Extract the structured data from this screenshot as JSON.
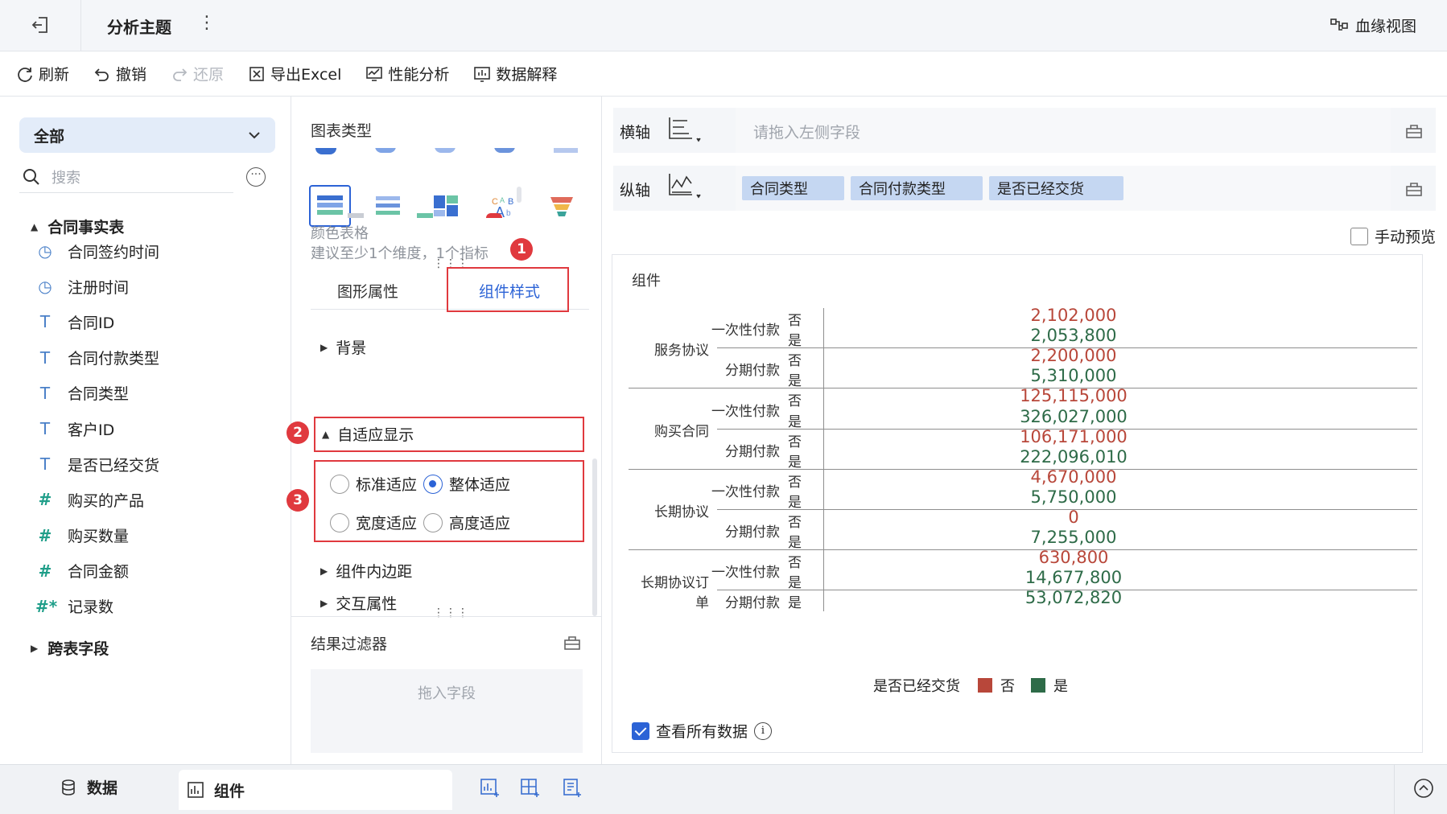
{
  "header": {
    "title": "分析主题",
    "lineage_label": "血缘视图"
  },
  "toolbar": {
    "refresh": "刷新",
    "undo": "撤销",
    "redo": "还原",
    "export_excel": "导出Excel",
    "perf_analysis": "性能分析",
    "data_explain": "数据解释"
  },
  "left_panel": {
    "scope": "全部",
    "search_placeholder": "搜索",
    "table_name": "合同事实表",
    "fields": [
      {
        "label": "合同签约时间",
        "icon": "clock-icon"
      },
      {
        "label": "注册时间",
        "icon": "clock-icon"
      },
      {
        "label": "合同ID",
        "icon": "text-type-icon"
      },
      {
        "label": "合同付款类型",
        "icon": "text-type-icon"
      },
      {
        "label": "合同类型",
        "icon": "text-type-icon"
      },
      {
        "label": "客户ID",
        "icon": "text-type-icon"
      },
      {
        "label": "是否已经交货",
        "icon": "text-type-icon"
      },
      {
        "label": "购买的产品",
        "icon": "number-type-icon"
      },
      {
        "label": "购买数量",
        "icon": "number-type-icon"
      },
      {
        "label": "合同金额",
        "icon": "number-type-icon"
      },
      {
        "label": "记录数",
        "icon": "count-type-icon"
      }
    ],
    "cross_table": "跨表字段"
  },
  "mid_panel": {
    "chart_type_title": "图表类型",
    "selected_chart_name": "颜色表格",
    "selected_chart_hint": "建议至少1个维度，1个指标",
    "tabs": [
      "图形属性",
      "组件样式"
    ],
    "active_tab": "组件样式",
    "props": {
      "background": "背景",
      "adaptive": "自适应显示",
      "padding": "组件内边距",
      "interaction": "交互属性"
    },
    "adaptive_options": [
      {
        "label": "标准适应",
        "checked": false
      },
      {
        "label": "整体适应",
        "checked": true
      },
      {
        "label": "宽度适应",
        "checked": false
      },
      {
        "label": "高度适应",
        "checked": false
      }
    ],
    "result_filter": "结果过滤器",
    "drop_hint": "拖入字段",
    "badges": [
      "1",
      "2",
      "3"
    ]
  },
  "right_panel": {
    "x_axis_label": "横轴",
    "x_placeholder": "请拖入左侧字段",
    "y_axis_label": "纵轴",
    "y_fields": [
      "合同类型",
      "合同付款类型",
      "是否已经交货"
    ],
    "manual_preview": "手动预览",
    "card_title": "组件",
    "legend_title": "是否已经交货",
    "legend": [
      {
        "label": "否",
        "color": "#b8473a"
      },
      {
        "label": "是",
        "color": "#2e6b48"
      }
    ],
    "view_all_data": "查看所有数据"
  },
  "chart_data": {
    "type": "table",
    "columns": [
      "合同类型",
      "合同付款类型",
      "是否已经交货",
      "value"
    ],
    "groups": [
      {
        "type": "服务协议",
        "rows": [
          {
            "pay": "一次性付款",
            "flag": "否",
            "value": "2,102,000"
          },
          {
            "pay": "一次性付款",
            "flag": "是",
            "value": "2,053,800"
          },
          {
            "pay": "分期付款",
            "flag": "否",
            "value": "2,200,000"
          },
          {
            "pay": "分期付款",
            "flag": "是",
            "value": "5,310,000"
          }
        ]
      },
      {
        "type": "购买合同",
        "rows": [
          {
            "pay": "一次性付款",
            "flag": "否",
            "value": "125,115,000"
          },
          {
            "pay": "一次性付款",
            "flag": "是",
            "value": "326,027,000"
          },
          {
            "pay": "分期付款",
            "flag": "否",
            "value": "106,171,000"
          },
          {
            "pay": "分期付款",
            "flag": "是",
            "value": "222,096,010"
          }
        ]
      },
      {
        "type": "长期协议",
        "rows": [
          {
            "pay": "一次性付款",
            "flag": "否",
            "value": "4,670,000"
          },
          {
            "pay": "一次性付款",
            "flag": "是",
            "value": "5,750,000"
          },
          {
            "pay": "分期付款",
            "flag": "否",
            "value": "0"
          },
          {
            "pay": "分期付款",
            "flag": "是",
            "value": "7,255,000"
          }
        ]
      },
      {
        "type": "长期协议订单",
        "rows": [
          {
            "pay": "一次性付款",
            "flag": "否",
            "value": "630,800"
          },
          {
            "pay": "一次性付款",
            "flag": "是",
            "value": "14,677,800"
          },
          {
            "pay": "分期付款",
            "flag": "是",
            "value": "53,072,820"
          }
        ]
      }
    ]
  },
  "bottom_bar": {
    "data_tab": "数据",
    "component_tab": "组件"
  }
}
